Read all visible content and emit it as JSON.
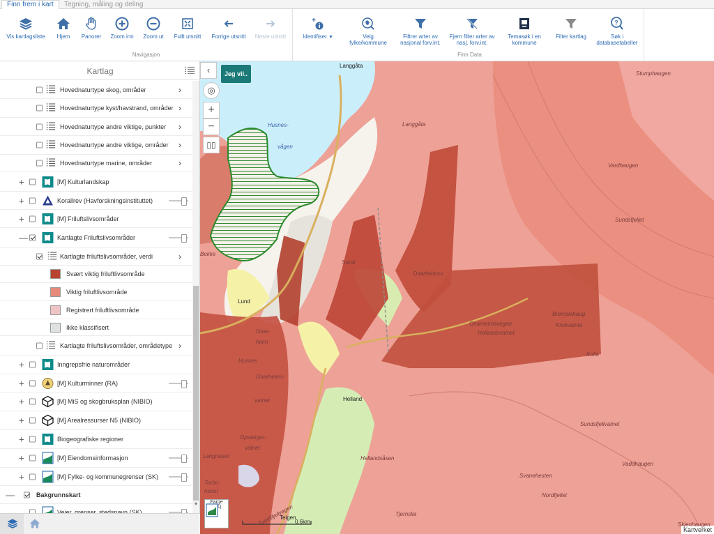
{
  "tabs": [
    {
      "label": "Finn frem i kart",
      "active": true
    },
    {
      "label": "Tegning, måling og deling",
      "active": false
    }
  ],
  "ribbon": {
    "navigasjon": {
      "label": "Navigasjon",
      "buttons": [
        {
          "label": "Vis kartlagsliste",
          "icon": "layers-icon"
        },
        {
          "label": "Hjem",
          "icon": "home-icon"
        },
        {
          "label": "Panorer",
          "icon": "hand-icon"
        },
        {
          "label": "Zoom inn",
          "icon": "zoom-in-icon"
        },
        {
          "label": "Zoom ut",
          "icon": "zoom-out-icon"
        },
        {
          "label": "Fullt utsnitt",
          "icon": "full-extent-icon"
        },
        {
          "label": "Forrige utsnitt",
          "icon": "previous-extent-icon"
        },
        {
          "label": "Neste utsnitt",
          "icon": "next-extent-icon"
        }
      ]
    },
    "finn_data": {
      "label": "Finn Data",
      "buttons": [
        {
          "label": "Identifiser",
          "icon": "identify-icon"
        },
        {
          "label": "Velg fylke/kommune",
          "icon": "select-area-icon"
        },
        {
          "label": "Filtrer arter av nasjonal forv.int.",
          "icon": "filter-icon"
        },
        {
          "label": "Fjern filter arter av nasj. forv.int.",
          "icon": "remove-filter-icon"
        },
        {
          "label": "Temasøk i en kommune",
          "icon": "theme-search-icon"
        },
        {
          "label": "Filter kartlag",
          "icon": "filter-layers-icon"
        },
        {
          "label": "Søk i databasetabeller",
          "icon": "database-search-icon"
        }
      ]
    }
  },
  "panel": {
    "title": "Kartlag"
  },
  "layers": [
    {
      "label": "Hovednaturtype skog, områder",
      "checked": false,
      "expander": "",
      "icon": "legend-list-icon",
      "trail": "chevron"
    },
    {
      "label": "Hovednaturtype kyst/havstrand, områder",
      "checked": false,
      "expander": "",
      "icon": "legend-list-icon",
      "trail": "chevron"
    },
    {
      "label": "Hovednaturtype andre viktige, punkter",
      "checked": false,
      "expander": "",
      "icon": "legend-list-icon",
      "trail": "chevron"
    },
    {
      "label": "Hovednaturtype andre viktige, områder",
      "checked": false,
      "expander": "",
      "icon": "legend-list-icon",
      "trail": "chevron"
    },
    {
      "label": "Hovednaturtype marine, områder",
      "checked": false,
      "expander": "",
      "icon": "legend-list-icon",
      "trail": "chevron"
    },
    {
      "label": "[M] Kulturlandskap",
      "checked": false,
      "expander": "+",
      "icon": "map-layer-icon",
      "trail": ""
    },
    {
      "label": "Korallrev (Havforskningsinstituttet)",
      "checked": false,
      "expander": "+",
      "icon": "coral-icon",
      "trail": "slider"
    },
    {
      "label": "[M] Friluftslivsområder",
      "checked": false,
      "expander": "+",
      "icon": "map-layer-icon",
      "trail": ""
    },
    {
      "label": "Kartlagte Friluftslivsområder",
      "checked": true,
      "expander": "—",
      "icon": "map-layer-icon",
      "trail": "slider"
    },
    {
      "label": "Kartlagte friluftslivsområder, verdi",
      "checked": true,
      "expander": "",
      "icon": "legend-list-icon",
      "trail": "chevron"
    },
    {
      "label": "Svært viktig friluftlivsområde",
      "swatch": "#b8432f"
    },
    {
      "label": "Viktig friluftlivsområde",
      "swatch": "#e58a7a"
    },
    {
      "label": "Registrert friluftlivsområde",
      "swatch": "#f0c4c6"
    },
    {
      "label": "Ikke klassifisert",
      "swatch": "#dfe3df"
    },
    {
      "label": "Kartlagte friluftslivsområder, områdetype",
      "checked": false,
      "expander": "",
      "icon": "legend-list-icon",
      "trail": "chevron"
    },
    {
      "label": "Inngrepsfrie naturområder",
      "checked": false,
      "expander": "+",
      "icon": "map-layer-icon",
      "trail": ""
    },
    {
      "label": "[M] Kulturminner (RA)",
      "checked": false,
      "expander": "+",
      "icon": "heritage-icon",
      "trail": "slider"
    },
    {
      "label": "[M] MiS og skogbruksplan (NIBIO)",
      "checked": false,
      "expander": "+",
      "icon": "cube-icon",
      "trail": ""
    },
    {
      "label": "[M] Arealressurser N5 (NIBIO)",
      "checked": false,
      "expander": "+",
      "icon": "cube-icon",
      "trail": ""
    },
    {
      "label": "Biogeografiske regioner",
      "checked": false,
      "expander": "+",
      "icon": "map-layer-icon",
      "trail": ""
    },
    {
      "label": "[M] Eiendomsinformasjon",
      "checked": false,
      "expander": "+",
      "icon": "kartverket-icon",
      "trail": "slider"
    },
    {
      "label": "[M] Fylke- og kommunegrenser (SK)",
      "checked": false,
      "expander": "+",
      "icon": "kartverket-icon",
      "trail": "slider"
    },
    {
      "label": "Bakgrunnskart",
      "checked": true,
      "expander": "—",
      "icon": "",
      "trail": "",
      "bold": true
    },
    {
      "label": "Veier, grenser, stedsnavn (SK)",
      "checked": false,
      "expander": "",
      "icon": "kartverket-icon",
      "trail": "slider"
    }
  ],
  "map": {
    "jeg_vil": "Jeg vil..",
    "basemap_label": "Farge (SK)",
    "scale_label": "0.6km",
    "attribution": "Kartverket",
    "places": [
      {
        "name": "Langgåta",
        "style": "dark"
      },
      {
        "name": "Langgåta",
        "style": "plain"
      },
      {
        "name": "Husnes-",
        "style": "blue"
      },
      {
        "name": "vågen",
        "style": "blue"
      },
      {
        "name": "Onarheimsv.",
        "style": "plain"
      },
      {
        "name": "Onarheimsvegen",
        "style": "plain"
      },
      {
        "name": "Søral",
        "style": "plain"
      },
      {
        "name": "Lund",
        "style": "dark"
      },
      {
        "name": "Onar-",
        "style": "plain"
      },
      {
        "name": "heim",
        "style": "plain"
      },
      {
        "name": "Husnes",
        "style": "plain"
      },
      {
        "name": "Onarheims-",
        "style": "plain"
      },
      {
        "name": "vatnet",
        "style": "plain"
      },
      {
        "name": "Helland",
        "style": "dark"
      },
      {
        "name": "Opsanger-",
        "style": "plain"
      },
      {
        "name": "vatnet",
        "style": "plain"
      },
      {
        "name": "Langneset",
        "style": "plain"
      },
      {
        "name": "Torbo-",
        "style": "plain"
      },
      {
        "name": "neset",
        "style": "plain"
      },
      {
        "name": "Teigen",
        "style": "dark"
      },
      {
        "name": "Vardhaugen",
        "style": "plain"
      },
      {
        "name": "Sundsfjellet",
        "style": "plain"
      },
      {
        "name": "Bremslahaug",
        "style": "plain"
      },
      {
        "name": "Krokvatnet",
        "style": "plain"
      },
      {
        "name": "Hellandsvatnet",
        "style": "plain"
      },
      {
        "name": "Kolla",
        "style": "plain"
      },
      {
        "name": "Sundsfjellvatnet",
        "style": "plain"
      },
      {
        "name": "Vaddhaugen",
        "style": "plain"
      },
      {
        "name": "Hellandsåsen",
        "style": "plain"
      },
      {
        "name": "Svanehesten",
        "style": "plain"
      },
      {
        "name": "Nordfjellet",
        "style": "plain"
      },
      {
        "name": "Tjernslia",
        "style": "plain"
      },
      {
        "name": "Skjenhaugen",
        "style": "plain"
      },
      {
        "name": "Stumphaugen",
        "style": "plain"
      },
      {
        "name": "Bekke",
        "style": "plain"
      },
      {
        "name": "Tveitlifjellvegen",
        "style": "plain"
      }
    ]
  }
}
